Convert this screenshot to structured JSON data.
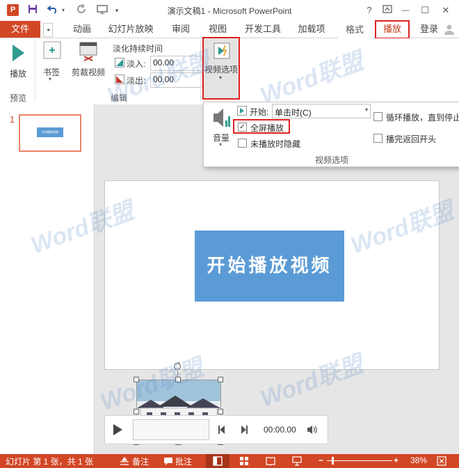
{
  "window": {
    "title": "演示文稿1 - Microsoft PowerPoint",
    "ppt_letter": "P",
    "help": "?",
    "minimize": "—",
    "restore": "☐",
    "close": "✕"
  },
  "tabs": {
    "file": "文件",
    "items": [
      "动画",
      "幻灯片放映",
      "审阅",
      "视图",
      "开发工具",
      "加载项",
      "格式",
      "播放"
    ],
    "login": "登录"
  },
  "ribbon": {
    "preview": {
      "play_label": "播放",
      "group": "预览"
    },
    "edit": {
      "bookmark": "书签",
      "trim": "剪裁视频",
      "fade_title": "淡化持续时间",
      "fade_in_label": "淡入:",
      "fade_in_value": "00.00",
      "fade_out_label": "淡出:",
      "fade_out_value": "00.00",
      "group": "编辑"
    },
    "video_options": {
      "label": "视频选项"
    }
  },
  "video_options_panel": {
    "volume": "音量",
    "start_label": "开始:",
    "start_value": "单击时(C)",
    "fullscreen": "全屏播放",
    "fullscreen_checked": "✓",
    "hide_when_not_playing": "未播放时隐藏",
    "loop": "循环播放，直到停止",
    "rewind": "播完返回开头",
    "group": "视频选项"
  },
  "slides_panel": {
    "slide_number": "1",
    "thumb_text": "开始播放视频"
  },
  "slide": {
    "button_text": "开始播放视频"
  },
  "player": {
    "time": "00:00.00"
  },
  "status": {
    "slide_info": "幻灯片 第 1 张，共 1 张",
    "notes": "备注",
    "comments": "批注",
    "zoom": "38%"
  },
  "watermark": {
    "text": "Word",
    "text2": "联盟",
    "site": "www.wordlm.com"
  },
  "colors": {
    "accent": "#d24726",
    "highlight": "#e02020",
    "slide_button": "#5b9bd5"
  }
}
